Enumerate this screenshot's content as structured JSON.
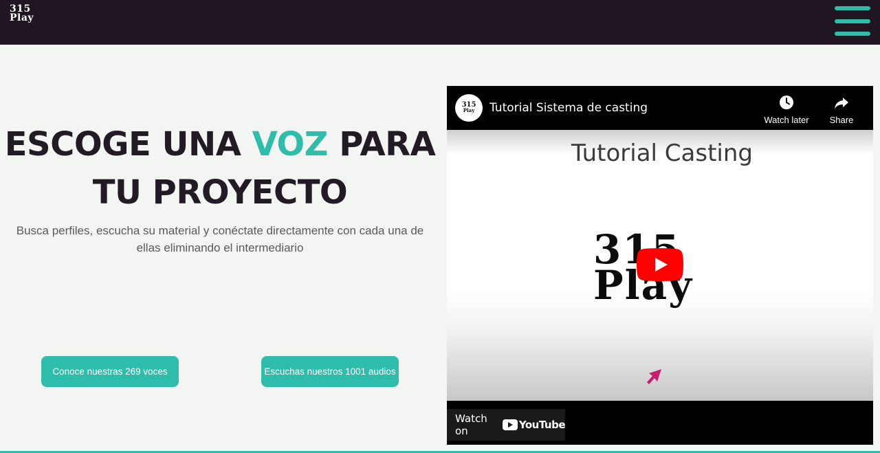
{
  "header": {
    "logo_line1": "315",
    "logo_line2": "Play",
    "menu_icon": "hamburger-menu-icon"
  },
  "hero": {
    "headline_part1": "ESCOGE UNA ",
    "headline_accent": "VOZ",
    "headline_part2": " PARA",
    "headline_line2": "TU PROYECTO",
    "subtext": "Busca perfiles, escucha su material y conéctate directamente con cada una de ellas eliminando el intermediario",
    "cta_voices": "Conoce nuestras 269 voces",
    "cta_audios": "Escuchas nuestros 1001 audios"
  },
  "video": {
    "channel_logo_line1": "315",
    "channel_logo_line2": "Play",
    "title": "Tutorial Sistema de casting",
    "watch_later_label": "Watch later",
    "share_label": "Share",
    "frame_title": "Tutorial Casting",
    "frame_logo_line1": "315",
    "frame_logo_line2": "Play",
    "watch_on_label": "Watch on",
    "youtube_label": "YouTube"
  },
  "colors": {
    "accent": "#2ebdaa",
    "header_bg": "#1f1621",
    "page_bg": "#f3f5f2",
    "headline": "#221a24",
    "youtube_red": "#ff0000"
  }
}
